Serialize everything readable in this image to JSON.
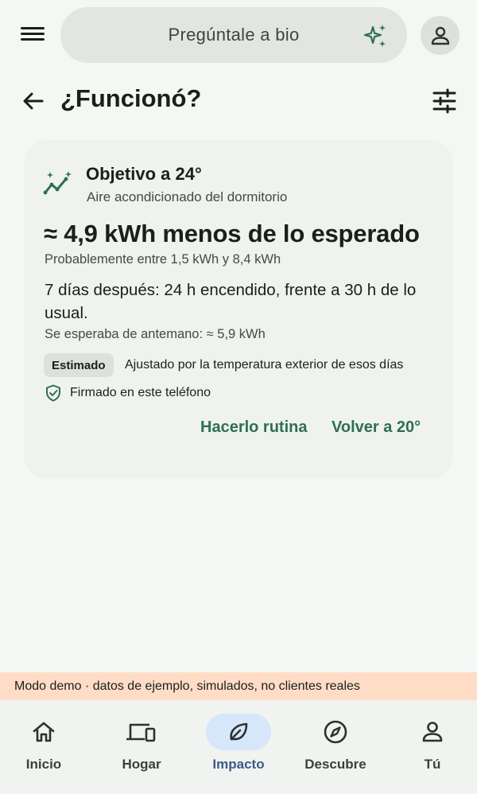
{
  "topbar": {
    "search_placeholder": "Pregúntale a bio"
  },
  "header": {
    "title": "¿Funcionó?"
  },
  "card": {
    "title": "Objetivo a 24°",
    "subtitle": "Aire acondicionado del dormitorio",
    "result": "≈ 4,9 kWh menos de lo esperado",
    "range": "Probablemente entre 1,5 kWh y 8,4 kWh",
    "detail": "7 días después: 24 h encendido, frente a 30 h de lo usual.",
    "expected": "Se esperaba de antemano: ≈ 5,9 kWh",
    "chip": "Estimado",
    "chip_note": "Ajustado por la temperatura exterior de esos días",
    "signed": "Firmado en este teléfono",
    "actions": [
      "Hacerlo rutina",
      "Volver a 20°"
    ]
  },
  "demo_banner": "Modo demo · datos de ejemplo, simulados, no clientes reales",
  "nav": {
    "active": "Impacto",
    "items": [
      {
        "label": "Inicio",
        "icon": "home-icon"
      },
      {
        "label": "Hogar",
        "icon": "devices-icon"
      },
      {
        "label": "Impacto",
        "icon": "leaf-icon"
      },
      {
        "label": "Descubre",
        "icon": "compass-icon"
      },
      {
        "label": "Tú",
        "icon": "person-icon"
      }
    ]
  },
  "colors": {
    "accent": "#2e6e55",
    "active_nav_bg": "#d6e6fb",
    "banner_bg": "#ffdcc6"
  }
}
